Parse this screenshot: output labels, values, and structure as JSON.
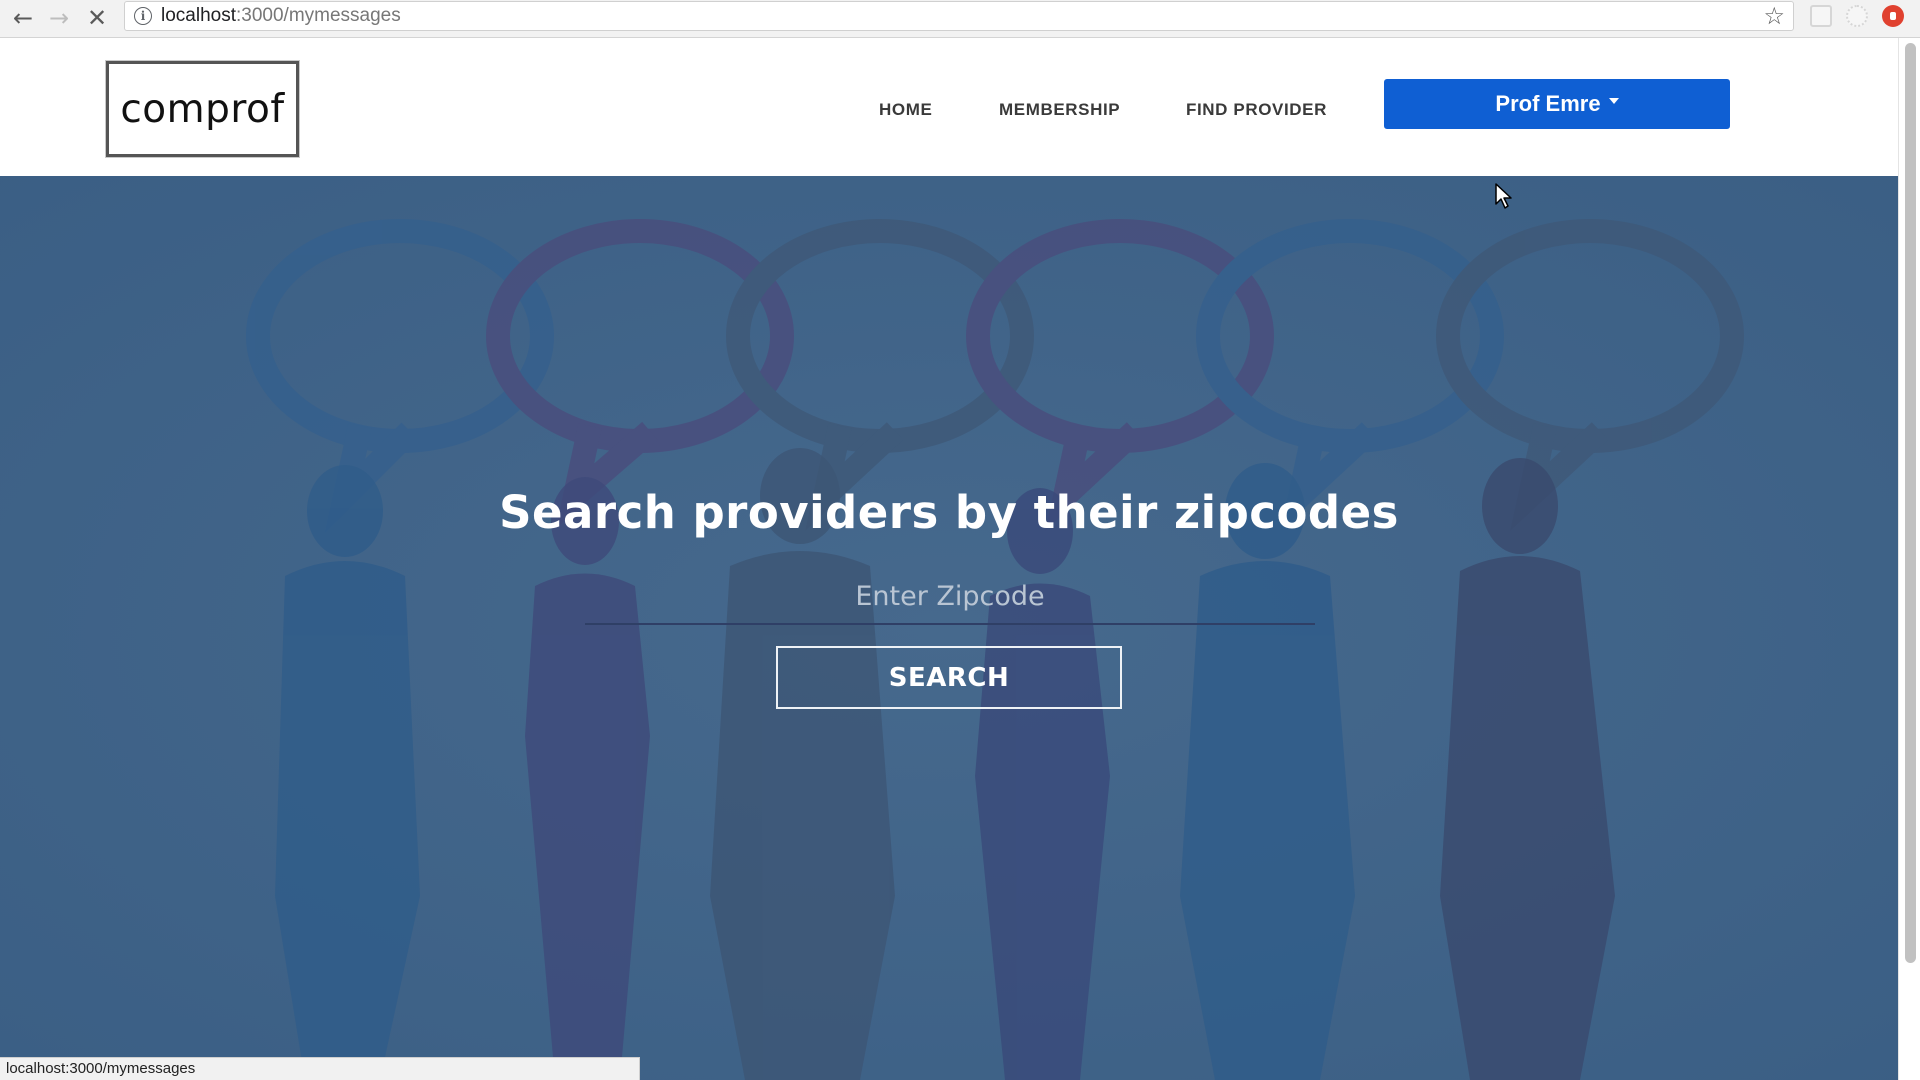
{
  "browser": {
    "url_host": "localhost",
    "url_path": ":3000/mymessages",
    "status_text": "localhost:3000/mymessages",
    "back_icon": "arrow-left-icon",
    "forward_icon": "arrow-right-icon",
    "stop_icon": "close-icon",
    "bookmark_icon": "star-icon"
  },
  "header": {
    "logo_text": "comprof",
    "nav": [
      {
        "label": "HOME"
      },
      {
        "label": "MEMBERSHIP"
      },
      {
        "label": "FIND PROVIDER"
      }
    ],
    "user_menu_label": "Prof Emre",
    "accent_color": "#0f5fd3"
  },
  "hero": {
    "title": "Search providers by their zipcodes",
    "zip_placeholder": "Enter Zipcode",
    "zip_value": "",
    "search_label": "SEARCH",
    "background_color": "#40658a"
  }
}
